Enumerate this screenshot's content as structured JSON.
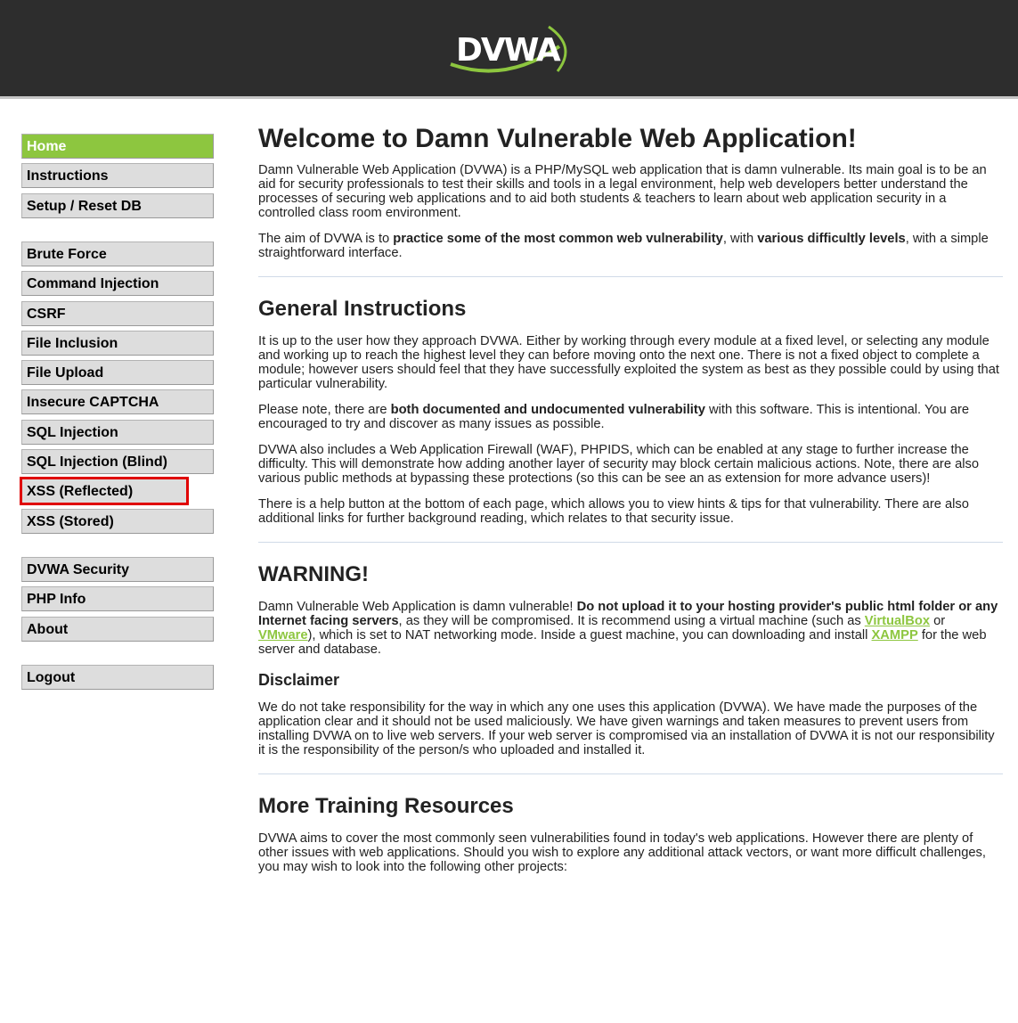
{
  "header": {
    "logo_text": "DVWA"
  },
  "sidebar": {
    "groups": [
      [
        "Home",
        "Instructions",
        "Setup / Reset DB"
      ],
      [
        "Brute Force",
        "Command Injection",
        "CSRF",
        "File Inclusion",
        "File Upload",
        "Insecure CAPTCHA",
        "SQL Injection",
        "SQL Injection (Blind)",
        "XSS (Reflected)",
        "XSS (Stored)"
      ],
      [
        "DVWA Security",
        "PHP Info",
        "About"
      ],
      [
        "Logout"
      ]
    ],
    "selected": "Home",
    "highlighted": "XSS (Reflected)"
  },
  "colors": {
    "accent": "#8dc63f",
    "header_bg": "#2d2d2d",
    "highlight_box": "#e00000"
  },
  "main": {
    "title": "Welcome to Damn Vulnerable Web Application!",
    "intro_p1": "Damn Vulnerable Web Application (DVWA) is a PHP/MySQL web application that is damn vulnerable. Its main goal is to be an aid for security professionals to test their skills and tools in a legal environment, help web developers better understand the processes of securing web applications and to aid both students & teachers to learn about web application security in a controlled class room environment.",
    "intro_p2_a": "The aim of DVWA is to ",
    "intro_p2_b": "practice some of the most common web vulnerability",
    "intro_p2_c": ", with ",
    "intro_p2_d": "various difficultly levels",
    "intro_p2_e": ", with a simple straightforward interface.",
    "general_heading": "General Instructions",
    "general_p1": "It is up to the user how they approach DVWA. Either by working through every module at a fixed level, or selecting any module and working up to reach the highest level they can before moving onto the next one. There is not a fixed object to complete a module; however users should feel that they have successfully exploited the system as best as they possible could by using that particular vulnerability.",
    "general_p2_a": "Please note, there are ",
    "general_p2_b": "both documented and undocumented vulnerability",
    "general_p2_c": " with this software. This is intentional. You are encouraged to try and discover as many issues as possible.",
    "general_p3": "DVWA also includes a Web Application Firewall (WAF), PHPIDS, which can be enabled at any stage to further increase the difficulty. This will demonstrate how adding another layer of security may block certain malicious actions. Note, there are also various public methods at bypassing these protections (so this can be see an as extension for more advance users)!",
    "general_p4": "There is a help button at the bottom of each page, which allows you to view hints & tips for that vulnerability. There are also additional links for further background reading, which relates to that security issue.",
    "warning_heading": "WARNING!",
    "warning_a": "Damn Vulnerable Web Application is damn vulnerable! ",
    "warning_b": "Do not upload it to your hosting provider's public html folder or any Internet facing servers",
    "warning_c": ", as they will be compromised. It is recommend using a virtual machine (such as ",
    "warning_link1": "VirtualBox",
    "warning_d": " or ",
    "warning_link2": "VMware",
    "warning_e": "), which is set to NAT networking mode. Inside a guest machine, you can downloading and install ",
    "warning_link3": "XAMPP",
    "warning_f": " for the web server and database.",
    "disclaimer_heading": "Disclaimer",
    "disclaimer_p": "We do not take responsibility for the way in which any one uses this application (DVWA). We have made the purposes of the application clear and it should not be used maliciously. We have given warnings and taken measures to prevent users from installing DVWA on to live web servers. If your web server is compromised via an installation of DVWA it is not our responsibility it is the responsibility of the person/s who uploaded and installed it.",
    "training_heading": "More Training Resources",
    "training_p": "DVWA aims to cover the most commonly seen vulnerabilities found in today's web applications. However there are plenty of other issues with web applications. Should you wish to explore any additional attack vectors, or want more difficult challenges, you may wish to look into the following other projects:"
  }
}
